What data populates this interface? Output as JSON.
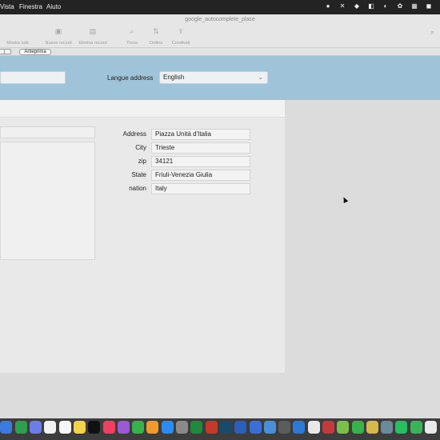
{
  "menubar": {
    "items": [
      "Vista",
      "Finestra",
      "Aiuto"
    ]
  },
  "window": {
    "title": "google_autocomplete_place",
    "toolbar": [
      {
        "label": "Mostra tutti",
        "icon": "list-icon"
      },
      {
        "label": "Nuovo record",
        "icon": "new-record-icon"
      },
      {
        "label": "Elimina record",
        "icon": "delete-record-icon"
      },
      {
        "label": "Trova",
        "icon": "search-icon"
      },
      {
        "label": "Ordina",
        "icon": "sort-icon"
      },
      {
        "label": "Condividi",
        "icon": "share-icon"
      }
    ],
    "preview_label": "Anteprima"
  },
  "header": {
    "language_label": "Langue address",
    "language_value": "English"
  },
  "form": {
    "fields": [
      {
        "label": "Address",
        "value": "Piazza Unità d'Italia"
      },
      {
        "label": "City",
        "value": "Trieste"
      },
      {
        "label": "zip",
        "value": "34121"
      },
      {
        "label": "State",
        "value": "Friuli-Venezia Giulia"
      },
      {
        "label": "nation",
        "value": "Italy"
      }
    ]
  },
  "colors": {
    "header_band": "#9fc3d8",
    "menubar": "#232323",
    "dock": "#3d3d3d"
  }
}
